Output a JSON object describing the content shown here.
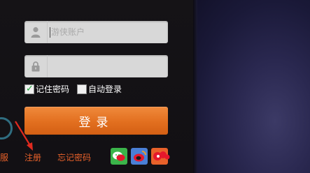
{
  "form": {
    "username_placeholder": "游侠账户",
    "password_placeholder": "",
    "remember_password_label": "记住密码",
    "remember_password_checked": true,
    "auto_login_label": "自动登录",
    "auto_login_checked": false,
    "login_button_label": "登录"
  },
  "links": {
    "service_partial": "服",
    "register": "注册",
    "forgot_password": "忘记密码"
  },
  "social_icons": [
    "wechat-icon",
    "sina-weibo-icon",
    "tencent-weibo-icon"
  ],
  "colors": {
    "accent": "#e26f1f",
    "link": "#e8612a",
    "input_bg": "#d8d8d8"
  }
}
